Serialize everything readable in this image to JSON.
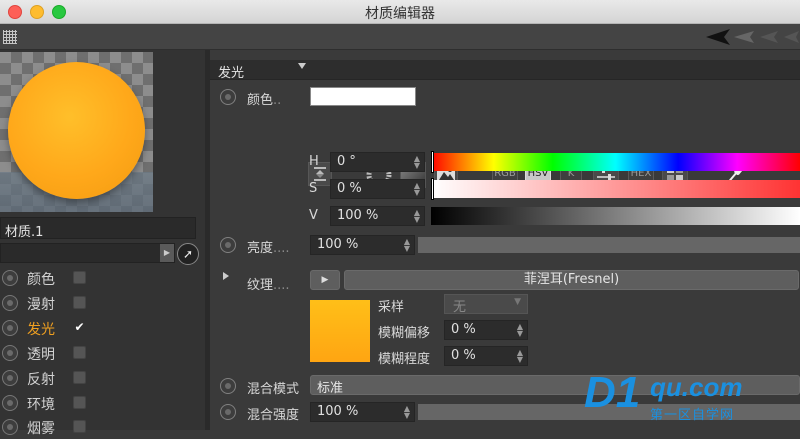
{
  "window": {
    "title": "材质编辑器"
  },
  "material": {
    "name": "材质.1"
  },
  "channels": [
    {
      "label": "颜色",
      "checked": false,
      "active": false
    },
    {
      "label": "漫射",
      "checked": false,
      "active": false
    },
    {
      "label": "发光",
      "checked": true,
      "active": true,
      "check_mark": "✔"
    },
    {
      "label": "透明",
      "checked": false,
      "active": false
    },
    {
      "label": "反射",
      "checked": false,
      "active": false
    },
    {
      "label": "环境",
      "checked": false,
      "active": false
    },
    {
      "label": "烟雾",
      "checked": false,
      "active": false
    }
  ],
  "section": {
    "title": "发光"
  },
  "color": {
    "label": "颜色",
    "dots": "..",
    "swatch": "#ffffff",
    "modes": [
      "RGB",
      "HSV",
      "K",
      "HEX"
    ],
    "selected_mode": "HSV",
    "h": {
      "label": "H",
      "value": "0 °"
    },
    "s": {
      "label": "S",
      "value": "0 %"
    },
    "v": {
      "label": "V",
      "value": "100 %"
    }
  },
  "brightness": {
    "label": "亮度",
    "dots": "....",
    "value": "100 %"
  },
  "texture": {
    "label": "纹理",
    "dots": "....",
    "shader": "菲涅耳(Fresnel)",
    "swatch": "#ffad14",
    "sampling": {
      "label": "采样",
      "value": "无"
    },
    "blur_offset": {
      "label": "模糊偏移",
      "value": "0 %"
    },
    "blur_scale": {
      "label": "模糊程度",
      "value": "0 %"
    }
  },
  "mix_mode": {
    "label": "混合模式",
    "value": "标准"
  },
  "mix_strength": {
    "label": "混合强度",
    "value": "100 %"
  },
  "watermark": {
    "brand_main": "D1",
    "brand_sub": "qu.com",
    "tagline": "第一区自学网"
  },
  "colors": {
    "accent": "#f0a020",
    "panel": "#3a3a3a",
    "dark": "#2c2c2c"
  }
}
